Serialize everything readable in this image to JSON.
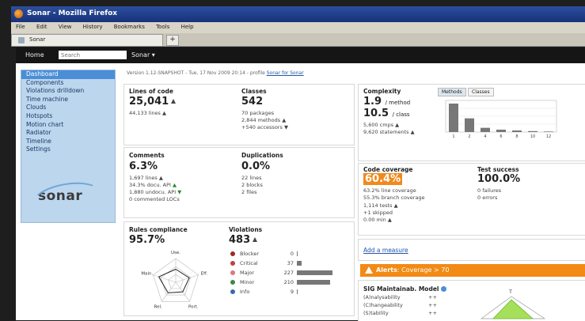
{
  "window": {
    "title": "Sonar - Mozilla Firefox"
  },
  "menu": [
    "File",
    "Edit",
    "View",
    "History",
    "Bookmarks",
    "Tools",
    "Help"
  ],
  "tab": {
    "label": "Sonar",
    "new_tab": "+"
  },
  "header": {
    "home": "Home",
    "search_placeholder": "Search",
    "project": "Sonar"
  },
  "sidebar": {
    "items": [
      "Dashboard",
      "Components",
      "Violations drilldown",
      "Time machine",
      "Clouds",
      "Hotspots",
      "Motion chart",
      "Radiator",
      "Timeline",
      "Settings"
    ],
    "logo": "sonar"
  },
  "version": {
    "text": "Version 1.12-SNAPSHOT - Tue, 17 Nov 2009 20:14 - profile",
    "link": "Sonar for Sonar"
  },
  "loc": {
    "title": "Lines of code",
    "value": "25,041",
    "lines": "44,133 lines"
  },
  "classes": {
    "title": "Classes",
    "value": "542",
    "packages": "70 packages",
    "methods": "2,844 methods",
    "accessors": "+540 accessors"
  },
  "comments": {
    "title": "Comments",
    "value": "6.3%",
    "lines": "1,697 lines",
    "docu_api": "34.3% docu. API",
    "undocu_api": "1,880 undocu. API",
    "loc": "0 commented LOCs"
  },
  "duplications": {
    "title": "Duplications",
    "value": "0.0%",
    "lines": "22 lines",
    "blocks": "2 blocks",
    "files": "2 files"
  },
  "rules": {
    "title": "Rules compliance",
    "value": "95.7%",
    "axes": [
      "Use.",
      "Eff.",
      "Port.",
      "Rel.",
      "Main."
    ],
    "scores": [
      0.55,
      0.6,
      0.5,
      0.55,
      0.75
    ]
  },
  "violations": {
    "title": "Violations",
    "value": "483",
    "rows": [
      {
        "label": "Blocker",
        "count": "0",
        "ratio": 0,
        "color": "#a02828"
      },
      {
        "label": "Critical",
        "count": "37",
        "ratio": 0.04,
        "color": "#c04040"
      },
      {
        "label": "Major",
        "count": "227",
        "ratio": 0.31,
        "color": "#d87a7a"
      },
      {
        "label": "Minor",
        "count": "210",
        "ratio": 0.29,
        "color": "#3a8a4a"
      },
      {
        "label": "Info",
        "count": "9",
        "ratio": 0.01,
        "color": "#3a6ab0"
      }
    ]
  },
  "complexity": {
    "title": "Complexity",
    "per_method_value": "1.9",
    "per_method_unit": "/ method",
    "per_class_value": "10.5",
    "per_class_unit": "/ class",
    "cmps": "5,600 cmps",
    "statements": "9,620 statements",
    "tab_methods": "Methods",
    "tab_classes": "Classes"
  },
  "coverage": {
    "title": "Code coverage",
    "value": "60.4%",
    "line": "63.2% line coverage",
    "branch": "55.3% branch coverage",
    "tests": "1,114 tests",
    "skipped": "+1 skipped",
    "time": "0.00 min"
  },
  "tests": {
    "title": "Test success",
    "value": "100.0%",
    "failures": "0 failures",
    "errors": "0 errors"
  },
  "measure": {
    "link": "Add a measure"
  },
  "alerts": {
    "label": "Alerts",
    "detail": ": Coverage > 70"
  },
  "model": {
    "title": "SIG Maintainab. Model",
    "rows": [
      {
        "label": "(A)nalysability",
        "value": "++"
      },
      {
        "label": "(C)hangeability",
        "value": "++"
      },
      {
        "label": "(S)tability",
        "value": "++"
      }
    ],
    "axis_top": "T"
  },
  "chart_data": {
    "type": "bar",
    "categories": [
      "1",
      "2",
      "4",
      "6",
      "8",
      "10",
      "12"
    ],
    "values": [
      540,
      260,
      80,
      45,
      30,
      18,
      10
    ],
    "ylim": [
      0,
      600
    ],
    "grid": true
  }
}
